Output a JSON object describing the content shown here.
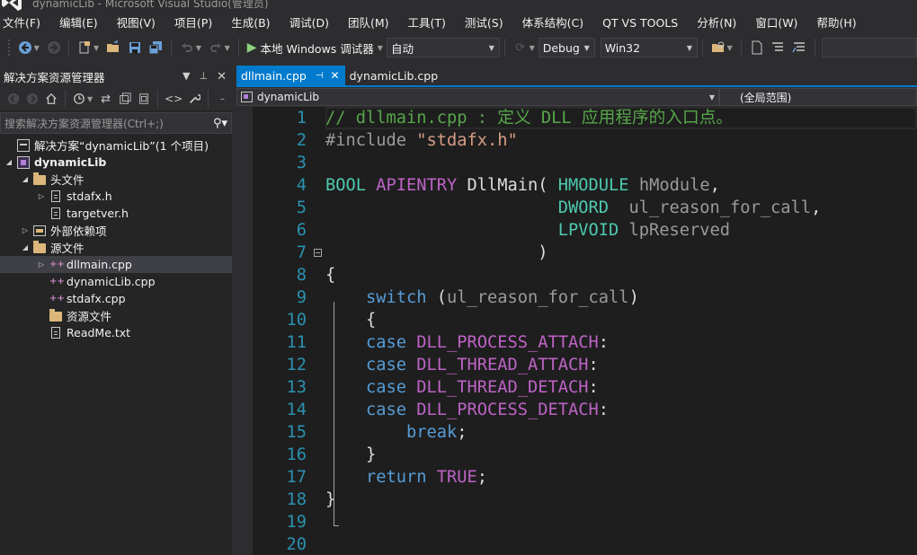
{
  "window": {
    "title": "dynamicLib - Microsoft Visual Studio(管理员)"
  },
  "menu": [
    "文件(F)",
    "编辑(E)",
    "视图(V)",
    "项目(P)",
    "生成(B)",
    "调试(D)",
    "团队(M)",
    "工具(T)",
    "测试(S)",
    "体系结构(C)",
    "QT VS TOOLS",
    "分析(N)",
    "窗口(W)",
    "帮助(H)"
  ],
  "toolbar": {
    "debugger_label": "本地 Windows 调试器",
    "launch_mode": "自动",
    "configuration": "Debug",
    "platform": "Win32",
    "icons": [
      "back-icon",
      "forward-icon",
      "new-project-icon",
      "open-file-icon",
      "save-icon",
      "save-all-icon",
      "undo-icon",
      "redo-icon",
      "start-debugging-icon",
      "refresh-icon",
      "find-in-files-icon",
      "comment-icon",
      "uncomment-icon"
    ]
  },
  "solution_explorer": {
    "title": "解决方案资源管理器",
    "search_placeholder": "搜索解决方案资源管理器(Ctrl+;)",
    "tree": [
      {
        "label": "解决方案“dynamicLib”(1 个项目)",
        "type": "solution",
        "expander": ""
      },
      {
        "label": "dynamicLib",
        "type": "project",
        "expander": "expanded"
      },
      {
        "label": "头文件",
        "type": "folder",
        "expander": "expanded"
      },
      {
        "label": "stdafx.h",
        "type": "header",
        "expander": "collapsed"
      },
      {
        "label": "targetver.h",
        "type": "header",
        "expander": ""
      },
      {
        "label": "外部依赖项",
        "type": "external",
        "expander": "collapsed"
      },
      {
        "label": "源文件",
        "type": "folder",
        "expander": "expanded"
      },
      {
        "label": "dllmain.cpp",
        "type": "cpp",
        "expander": "collapsed",
        "selected": true
      },
      {
        "label": "dynamicLib.cpp",
        "type": "cpp",
        "expander": ""
      },
      {
        "label": "stdafx.cpp",
        "type": "cpp",
        "expander": ""
      },
      {
        "label": "资源文件",
        "type": "folder",
        "expander": ""
      },
      {
        "label": "ReadMe.txt",
        "type": "text",
        "expander": ""
      }
    ]
  },
  "editor": {
    "tabs": [
      {
        "label": "dllmain.cpp",
        "active": true
      },
      {
        "label": "dynamicLib.cpp",
        "active": false
      }
    ],
    "nav_project": "dynamicLib",
    "nav_scope": "(全局范围)",
    "lines": [
      {
        "n": "1",
        "tokens": [
          [
            "c-comment",
            "// dllmain.cpp : 定义 DLL 应用程序的入口点。"
          ]
        ]
      },
      {
        "n": "2",
        "tokens": [
          [
            "c-pre",
            "#include "
          ],
          [
            "c-str",
            "\"stdafx.h\""
          ]
        ]
      },
      {
        "n": "3",
        "tokens": []
      },
      {
        "n": "4",
        "tokens": [
          [
            "c-type",
            "BOOL "
          ],
          [
            "c-macro",
            "APIENTRY "
          ],
          [
            "c-plain",
            "DllMain( "
          ],
          [
            "c-type",
            "HMODULE "
          ],
          [
            "c-param",
            "hModule"
          ],
          [
            "c-plain",
            ","
          ]
        ]
      },
      {
        "n": "5",
        "tokens": [
          [
            "c-plain",
            "                       "
          ],
          [
            "c-type",
            "DWORD  "
          ],
          [
            "c-param",
            "ul_reason_for_call"
          ],
          [
            "c-plain",
            ","
          ]
        ]
      },
      {
        "n": "6",
        "tokens": [
          [
            "c-plain",
            "                       "
          ],
          [
            "c-type",
            "LPVOID "
          ],
          [
            "c-param",
            "lpReserved"
          ]
        ]
      },
      {
        "n": "7",
        "tokens": [
          [
            "c-plain",
            "                     )"
          ]
        ],
        "fold": "open"
      },
      {
        "n": "8",
        "tokens": [
          [
            "c-plain",
            "{"
          ]
        ]
      },
      {
        "n": "9",
        "tokens": [
          [
            "c-plain",
            "    "
          ],
          [
            "c-kw",
            "switch "
          ],
          [
            "c-plain",
            "("
          ],
          [
            "c-param",
            "ul_reason_for_call"
          ],
          [
            "c-plain",
            ")"
          ]
        ]
      },
      {
        "n": "10",
        "tokens": [
          [
            "c-plain",
            "    {"
          ]
        ]
      },
      {
        "n": "11",
        "tokens": [
          [
            "c-plain",
            "    "
          ],
          [
            "c-kw",
            "case "
          ],
          [
            "c-macro",
            "DLL_PROCESS_ATTACH"
          ],
          [
            "c-plain",
            ":"
          ]
        ]
      },
      {
        "n": "12",
        "tokens": [
          [
            "c-plain",
            "    "
          ],
          [
            "c-kw",
            "case "
          ],
          [
            "c-macro",
            "DLL_THREAD_ATTACH"
          ],
          [
            "c-plain",
            ":"
          ]
        ]
      },
      {
        "n": "13",
        "tokens": [
          [
            "c-plain",
            "    "
          ],
          [
            "c-kw",
            "case "
          ],
          [
            "c-macro",
            "DLL_THREAD_DETACH"
          ],
          [
            "c-plain",
            ":"
          ]
        ]
      },
      {
        "n": "14",
        "tokens": [
          [
            "c-plain",
            "    "
          ],
          [
            "c-kw",
            "case "
          ],
          [
            "c-macro",
            "DLL_PROCESS_DETACH"
          ],
          [
            "c-plain",
            ":"
          ]
        ]
      },
      {
        "n": "15",
        "tokens": [
          [
            "c-plain",
            "        "
          ],
          [
            "c-kw",
            "break"
          ],
          [
            "c-plain",
            ";"
          ]
        ]
      },
      {
        "n": "16",
        "tokens": [
          [
            "c-plain",
            "    }"
          ]
        ]
      },
      {
        "n": "17",
        "tokens": [
          [
            "c-plain",
            "    "
          ],
          [
            "c-kw",
            "return "
          ],
          [
            "c-macro",
            "TRUE"
          ],
          [
            "c-plain",
            ";"
          ]
        ]
      },
      {
        "n": "18",
        "tokens": [
          [
            "c-plain",
            "}"
          ]
        ]
      },
      {
        "n": "19",
        "tokens": []
      },
      {
        "n": "20",
        "tokens": []
      }
    ]
  }
}
